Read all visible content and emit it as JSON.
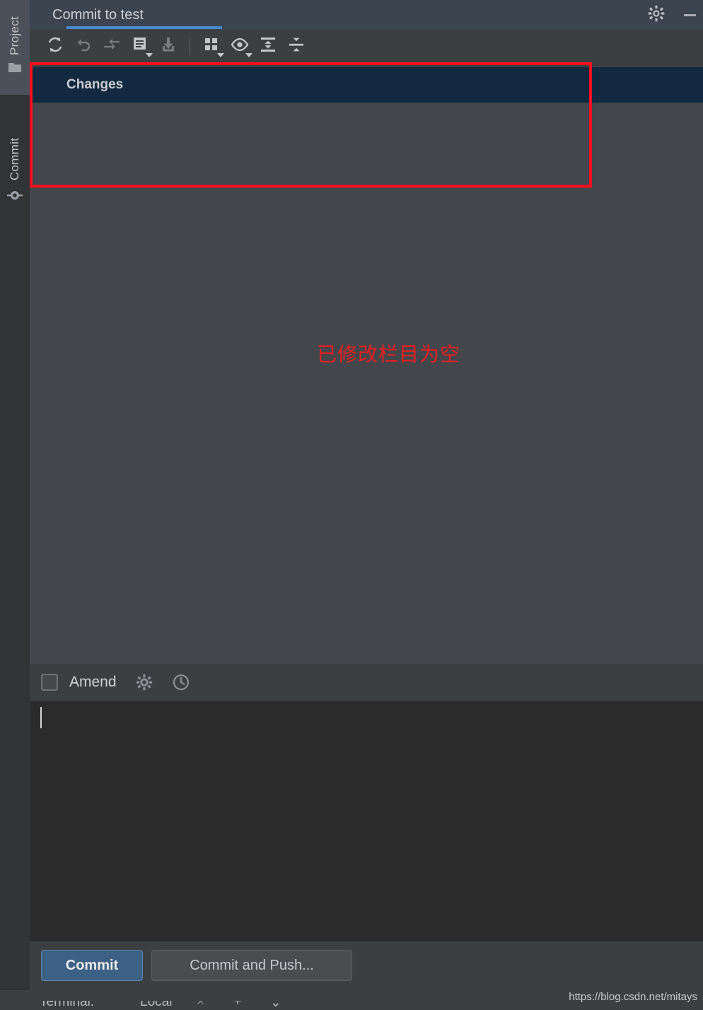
{
  "window": {
    "title": "Commit to test"
  },
  "sidebar": {
    "items": [
      {
        "label": "Project",
        "icon": "folder-icon"
      },
      {
        "label": "Commit",
        "icon": "commit-node-icon"
      }
    ]
  },
  "tabbar": {
    "tab_label": "Commit to test",
    "settings_icon": "gear-icon",
    "minimize_icon": "minimize-icon"
  },
  "toolbar": {
    "buttons": [
      {
        "name": "refresh-changes-button",
        "icon": "refresh-icon",
        "enabled": true,
        "dropdown": false
      },
      {
        "name": "rollback-button",
        "icon": "undo-icon",
        "enabled": false,
        "dropdown": false
      },
      {
        "name": "shelve-changes-button",
        "icon": "shelve-arrow-icon",
        "enabled": false,
        "dropdown": false
      },
      {
        "name": "show-diff-button",
        "icon": "diff-document-icon",
        "enabled": true,
        "dropdown": true
      },
      {
        "name": "update-project-button",
        "icon": "download-icon",
        "enabled": false,
        "dropdown": false
      },
      {
        "name": "group-by-button",
        "icon": "group-by-squares-icon",
        "enabled": true,
        "dropdown": true
      },
      {
        "name": "preview-diff-button",
        "icon": "eye-icon",
        "enabled": true,
        "dropdown": true
      },
      {
        "name": "expand-all-button",
        "icon": "expand-all-icon",
        "enabled": true,
        "dropdown": false
      },
      {
        "name": "collapse-all-button",
        "icon": "collapse-all-icon",
        "enabled": true,
        "dropdown": false
      }
    ]
  },
  "changes_panel": {
    "header_title": "Changes",
    "items": []
  },
  "annotation": {
    "text": "已修改栏目为空",
    "rect_color": "#fa0f1e",
    "text_color": "#e81f23"
  },
  "amend_row": {
    "label": "Amend",
    "checked": false,
    "settings_icon": "gear-icon",
    "history_icon": "clock-history-icon"
  },
  "commit_message": {
    "value": "",
    "placeholder": ""
  },
  "buttons": {
    "commit_label": "Commit",
    "commit_and_push_label": "Commit and Push...",
    "commit_color": "#3d6185"
  },
  "bottom_bar": {
    "terminal_label": "Terminal:",
    "session_label": "Local",
    "close_label": "×",
    "add_label": "+",
    "chevron_label": "⌄"
  },
  "watermark": {
    "text": "https://blog.csdn.net/mitays"
  }
}
